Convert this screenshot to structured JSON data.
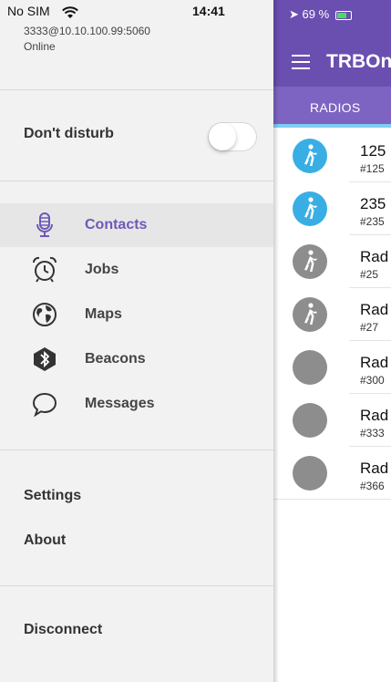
{
  "drawer": {
    "status": {
      "carrier": "No SIM",
      "time": "14:41"
    },
    "account": {
      "address": "3333@10.10.100.99:5060",
      "state": "Online"
    },
    "dnd_label": "Don't disturb",
    "dnd_on": false,
    "menu": [
      {
        "label": "Contacts",
        "icon": "microphone-icon",
        "active": true
      },
      {
        "label": "Jobs",
        "icon": "alarm-clock-icon",
        "active": false
      },
      {
        "label": "Maps",
        "icon": "globe-icon",
        "active": false
      },
      {
        "label": "Beacons",
        "icon": "bluetooth-beacon-icon",
        "active": false
      },
      {
        "label": "Messages",
        "icon": "chat-bubble-icon",
        "active": false
      }
    ],
    "settings_label": "Settings",
    "about_label": "About",
    "disconnect_label": "Disconnect"
  },
  "panel": {
    "status": {
      "battery": "69 %"
    },
    "title": "TRBOn",
    "tab_label": "RADIOS",
    "rows": [
      {
        "name": "125",
        "number": "#125",
        "avatar": "walker-icon",
        "color": "#39aee5"
      },
      {
        "name": "235",
        "number": "#235",
        "avatar": "walker-icon",
        "color": "#39aee5"
      },
      {
        "name": "Rad",
        "number": "#25",
        "avatar": "walker-icon",
        "color": "#8d8d8d"
      },
      {
        "name": "Rad",
        "number": "#27",
        "avatar": "walker-icon",
        "color": "#8d8d8d"
      },
      {
        "name": "Rad",
        "number": "#300",
        "avatar": "none",
        "color": "#8d8d8d"
      },
      {
        "name": "Rad",
        "number": "#333",
        "avatar": "none",
        "color": "#8d8d8d"
      },
      {
        "name": "Rad",
        "number": "#366",
        "avatar": "none",
        "color": "#8d8d8d"
      }
    ]
  },
  "colors": {
    "accent": "#6f58b8",
    "appbar": "#6a4fb0",
    "tabbar": "#7d64c2",
    "indicator": "#7fcdf2"
  }
}
